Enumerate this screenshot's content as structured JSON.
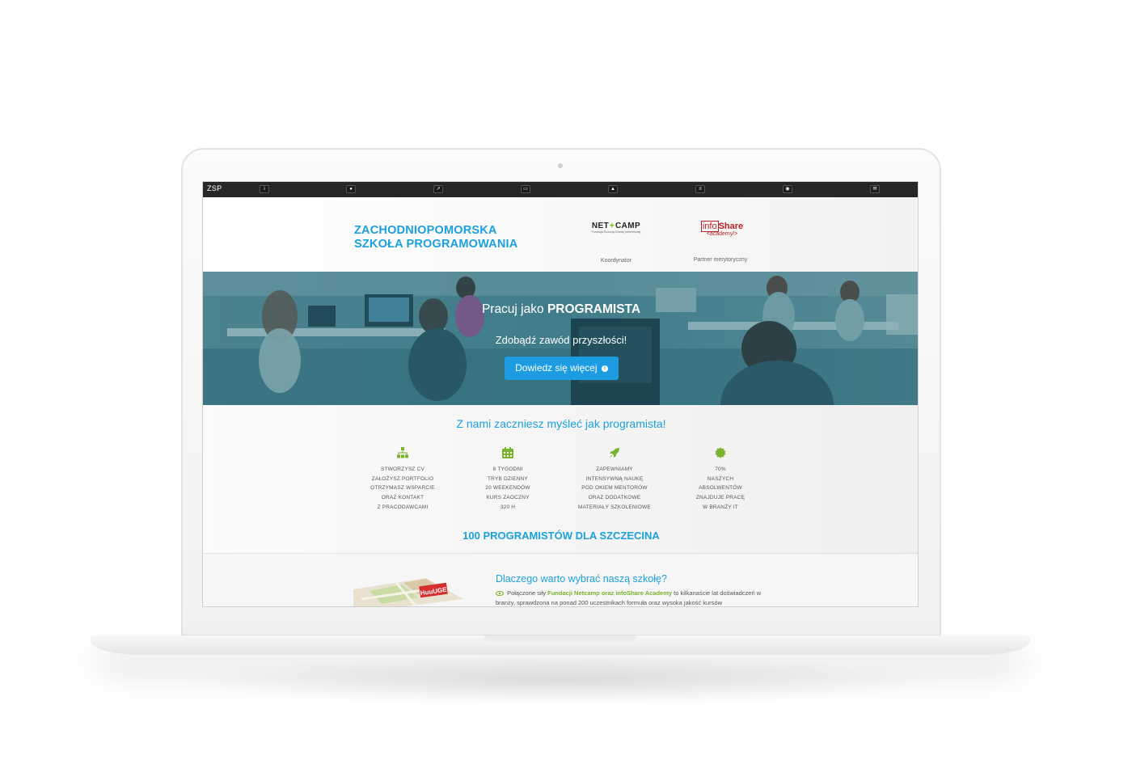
{
  "navbar": {
    "brand": "ZSP",
    "icons": [
      "info-icon",
      "paw-icon",
      "line-chart-icon",
      "monitor-icon",
      "graduation-cap-icon",
      "list-icon",
      "eye-icon",
      "envelope-icon"
    ]
  },
  "header": {
    "title_line1": "ZACHODNIOPOMORSKA",
    "title_line2": "SZKOŁA PROGRAMOWANIA",
    "partner1": {
      "logo_left": "NET",
      "logo_right": "CAMP",
      "logo_sub": "Fundacja Rozwoju Branży Internetowej",
      "role": "Koordynator"
    },
    "partner2": {
      "logo_info": "info",
      "logo_share": "Share",
      "logo_academy": "<academy/>",
      "role": "Partner merytoryczny"
    }
  },
  "hero": {
    "title_prefix": "Pracuj jako",
    "title_bold": "PROGRAMISTA",
    "subtitle": "Zdobądź zawód przyszłości!",
    "button_label": "Dowiedz się więcej"
  },
  "features": {
    "heading": "Z nami zaczniesz myśleć jak programista!",
    "items": [
      {
        "icon": "sitemap-icon",
        "lines": [
          "STWORZYSZ CV",
          "ZAŁOŻYSZ PORTFOLIO",
          "OTRZYMASZ WSPARCIE",
          "ORAZ KONTAKT",
          "Z PRACODAWCAMI"
        ]
      },
      {
        "icon": "calendar-icon",
        "lines": [
          "8 TYGODNI",
          "TRYB DZIENNY",
          "20 WEEKENDÓW",
          "KURS ZAOCZNY",
          "320 H"
        ]
      },
      {
        "icon": "rocket-icon",
        "lines": [
          "ZAPEWNIAMY",
          "INTENSYWNĄ NAUKĘ",
          "POD OKIEM MENTORÓW",
          "ORAZ DODATKOWE",
          "MATERIAŁY SZKOLENIOWE"
        ]
      },
      {
        "icon": "badge-icon",
        "lines": [
          "70%",
          "NASZYCH",
          "ABSOLWENTÓW",
          "ZNAJDUJE PRACĘ",
          "W BRANŻY IT"
        ]
      }
    ],
    "promo": "100 PROGRAMISTÓW DLA SZCZECINA"
  },
  "why": {
    "map_badge": "HuuUGE",
    "title": "Dlaczego warto wybrać naszą szkołę?",
    "text_before": "Połączone siły",
    "text_highlight": "Fundacji Netcamp oraz infoShare Academy",
    "text_after": "to kilkanaście lat doświadczeń w branży, sprawdzona na ponad 200 uczestnikach formuła oraz wysoka jakość kursów"
  },
  "colors": {
    "accent_blue": "#1aa0de",
    "button_blue": "#1e9ce2",
    "icon_green": "#7ab32e",
    "navbar": "#262626",
    "infoshare_red": "#b72025"
  }
}
